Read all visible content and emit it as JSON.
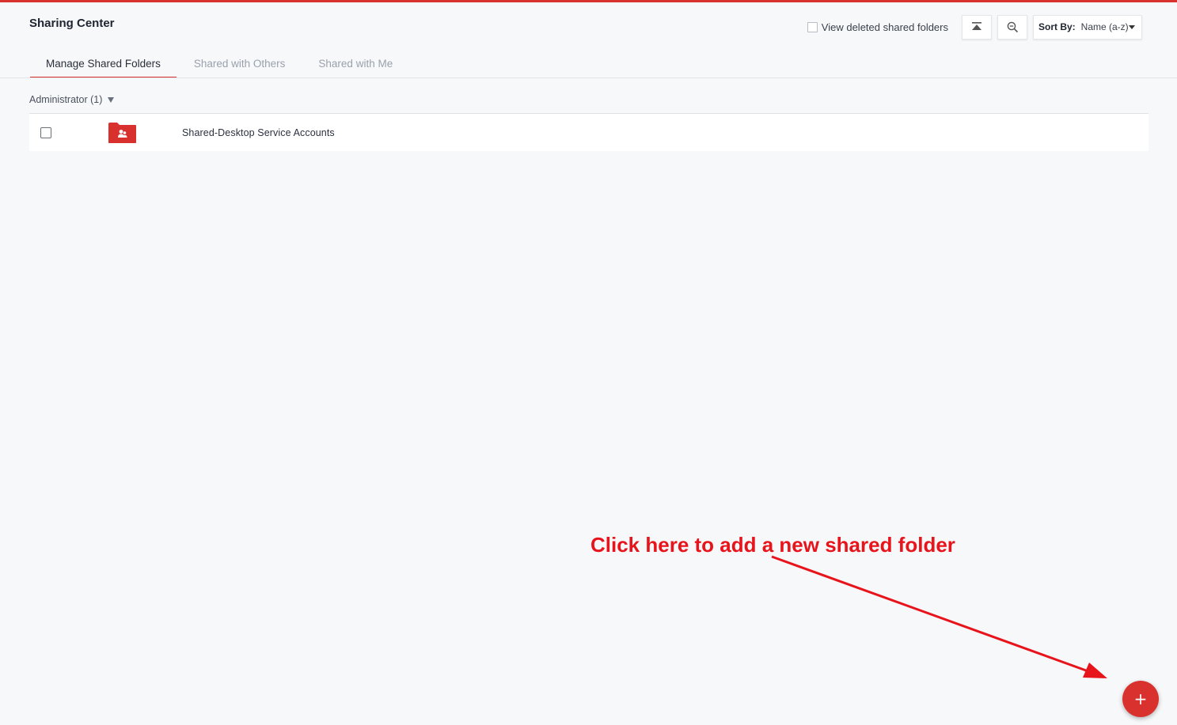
{
  "header": {
    "title": "Sharing Center",
    "view_deleted_label": "View deleted shared folders",
    "sort_label": "Sort By:",
    "sort_value": "Name (a-z)"
  },
  "tabs": [
    {
      "label": "Manage Shared Folders",
      "active": true
    },
    {
      "label": "Shared with Others",
      "active": false
    },
    {
      "label": "Shared with Me",
      "active": false
    }
  ],
  "group": {
    "label": "Administrator (1)"
  },
  "folders": [
    {
      "name": "Shared-Desktop Service Accounts",
      "icon": "shared-folder-icon"
    }
  ],
  "annotation": {
    "text": "Click here to add a new shared folder"
  },
  "fab": {
    "symbol": "+"
  },
  "colors": {
    "accent": "#d9322e",
    "annotation": "#e8141b"
  }
}
